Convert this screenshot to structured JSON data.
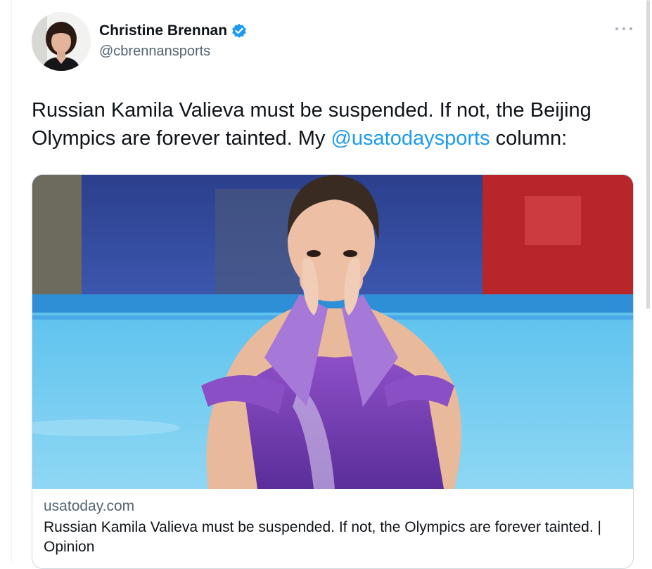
{
  "tweet": {
    "author": {
      "display_name": "Christine Brennan",
      "handle": "@cbrennansports",
      "verified": true
    },
    "text_before_mention": "Russian Kamila Valieva must be suspended. If not, the Beijing Olympics are forever tainted. My ",
    "mention": "@usatodaysports",
    "text_after_mention": " column:",
    "more_icon": "more-horizontal-icon"
  },
  "card": {
    "domain": "usatoday.com",
    "title": "Russian Kamila Valieva must be suspended. If not, the Olympics are forever tainted. | Opinion"
  },
  "colors": {
    "link": "#1d9bf0",
    "secondary_text": "#536471",
    "verified_badge": "#1d9bf0",
    "border": "#cfd9de"
  }
}
